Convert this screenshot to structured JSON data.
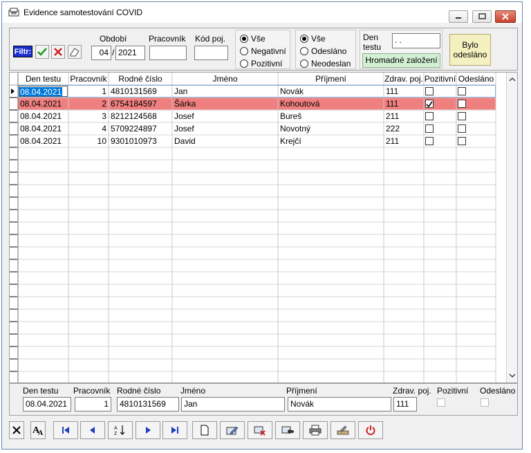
{
  "window": {
    "title": "Evidence samotestování COVID"
  },
  "filter": {
    "label": "Filtr:",
    "obdobi_label": "Období",
    "obdobi_month": "04",
    "obdobi_sep": "/",
    "obdobi_year": "2021",
    "pracovnik_label": "Pracovník",
    "pracovnik_value": "",
    "kodpoj_label": "Kód poj.",
    "kodpoj_value": "",
    "result_options": [
      "Vše",
      "Negativní",
      "Pozitivní"
    ],
    "result_selected": 0,
    "sent_options": [
      "Vše",
      "Odesláno",
      "Neodeslan"
    ],
    "sent_selected": 0,
    "den_testu_label_1": "Den",
    "den_testu_label_2": "testu",
    "den_testu_value": "  .  .",
    "bulk_button": "Hromadné založení",
    "sent_button_1": "Bylo",
    "sent_button_2": "odesláno"
  },
  "grid": {
    "columns": [
      "Den testu",
      "Pracovník",
      "Rodné číslo",
      "Jméno",
      "Příjmení",
      "Zdrav. poj.",
      "Pozitivní",
      "Odesláno"
    ],
    "rows": [
      {
        "date": "08.04.2021",
        "worker": "1",
        "rc": "4810131569",
        "first": "Jan",
        "last": "Novák",
        "ins": "111",
        "positive": false,
        "sent": false,
        "state": "current"
      },
      {
        "date": "08.04.2021",
        "worker": "2",
        "rc": "6754184597",
        "first": "Šárka",
        "last": "Kohoutová",
        "ins": "111",
        "positive": true,
        "sent": false,
        "state": "highlight"
      },
      {
        "date": "08.04.2021",
        "worker": "3",
        "rc": "8212124568",
        "first": "Josef",
        "last": "Bureš",
        "ins": "211",
        "positive": false,
        "sent": false,
        "state": ""
      },
      {
        "date": "08.04.2021",
        "worker": "4",
        "rc": "5709224897",
        "first": "Josef",
        "last": "Novotný",
        "ins": "222",
        "positive": false,
        "sent": false,
        "state": ""
      },
      {
        "date": "08.04.2021",
        "worker": "10",
        "rc": "9301010973",
        "first": "David",
        "last": "Krejčí",
        "ins": "211",
        "positive": false,
        "sent": false,
        "state": ""
      }
    ],
    "highlight_color": "#f08080",
    "selected_color": "#0078d7"
  },
  "detail": {
    "labels": [
      "Den testu",
      "Pracovník",
      "Rodné číslo",
      "Jméno",
      "Příjmení",
      "Zdrav. poj.",
      "Pozitivní",
      "Odesláno"
    ],
    "date": "08.04.2021",
    "worker": "1",
    "rc": "4810131569",
    "first": "Jan",
    "last": "Novák",
    "ins": "111"
  },
  "toolbar": {
    "icons": [
      "close-icon",
      "font-icon",
      "first-record-icon",
      "previous-record-icon",
      "sort-icon",
      "next-record-icon",
      "last-record-icon",
      "new-record-icon",
      "edit-record-icon",
      "delete-record-icon",
      "find-icon",
      "print-icon",
      "tool-icon",
      "power-icon"
    ]
  }
}
